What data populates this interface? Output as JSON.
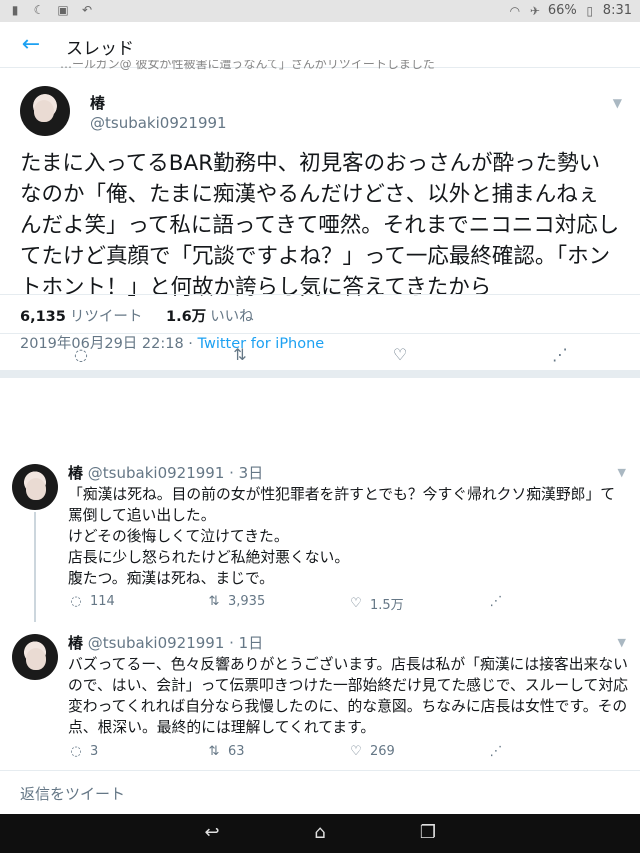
{
  "status_bar": {
    "left_icons": [
      "image-icon",
      "moon-icon",
      "photo-icon",
      "back-arrow-icon"
    ],
    "battery": "66%",
    "time": "8:31"
  },
  "header": {
    "title": "スレッド"
  },
  "cut_text": "…ールガン@ 彼女が性被害に遭うなんて」さんがリツイートしました",
  "main_tweet": {
    "name": "椿",
    "handle": "@tsubaki0921991",
    "text": "たまに入ってるBAR勤務中、初見客のおっさんが酔った勢いなのか「俺、たまに痴漢やるんだけどさ、以外と捕まんねぇんだよ笑」って私に語ってきて唖然。それまでニコニコ対応してたけど真顔で「冗談ですよね？」って一応最終確認。「ホントホント！」と何故か誇らし気に答えてきたから",
    "datetime": "2019年06月29日 22:18 · ",
    "source": "Twitter for iPhone",
    "retweets_count": "6,135",
    "retweets_label": "リツイート",
    "likes_count": "1.6万",
    "likes_label": "いいね"
  },
  "replies": [
    {
      "name": "椿",
      "handle": "@tsubaki0921991",
      "time": " · 3日",
      "text": "「痴漢は死ね。目の前の女が性犯罪者を許すとでも？今すぐ帰れクソ痴漢野郎」て罵倒して追い出した。\nけどその後悔しくて泣けてきた。\n店長に少し怒られたけど私絶対悪くない。\n腹たつ。痴漢は死ね、まじで。",
      "replies": "114",
      "retweets": "3,935",
      "likes": "1.5万"
    },
    {
      "name": "椿",
      "handle": "@tsubaki0921991",
      "time": " · 1日",
      "text": "バズってるー、色々反響ありがとうございます。店長は私が「痴漢には接客出来ないので、はい、会計」って伝票叩きつけた一部始終だけ見てた感じで、スルーして対応変わってくれれば自分なら我慢したのに、的な意図。ちなみに店長は女性です。その点、根深い。最終的には理解してくれてます。",
      "replies": "3",
      "retweets": "63",
      "likes": "269"
    }
  ],
  "reply_bar": {
    "placeholder": "返信をツイート"
  }
}
